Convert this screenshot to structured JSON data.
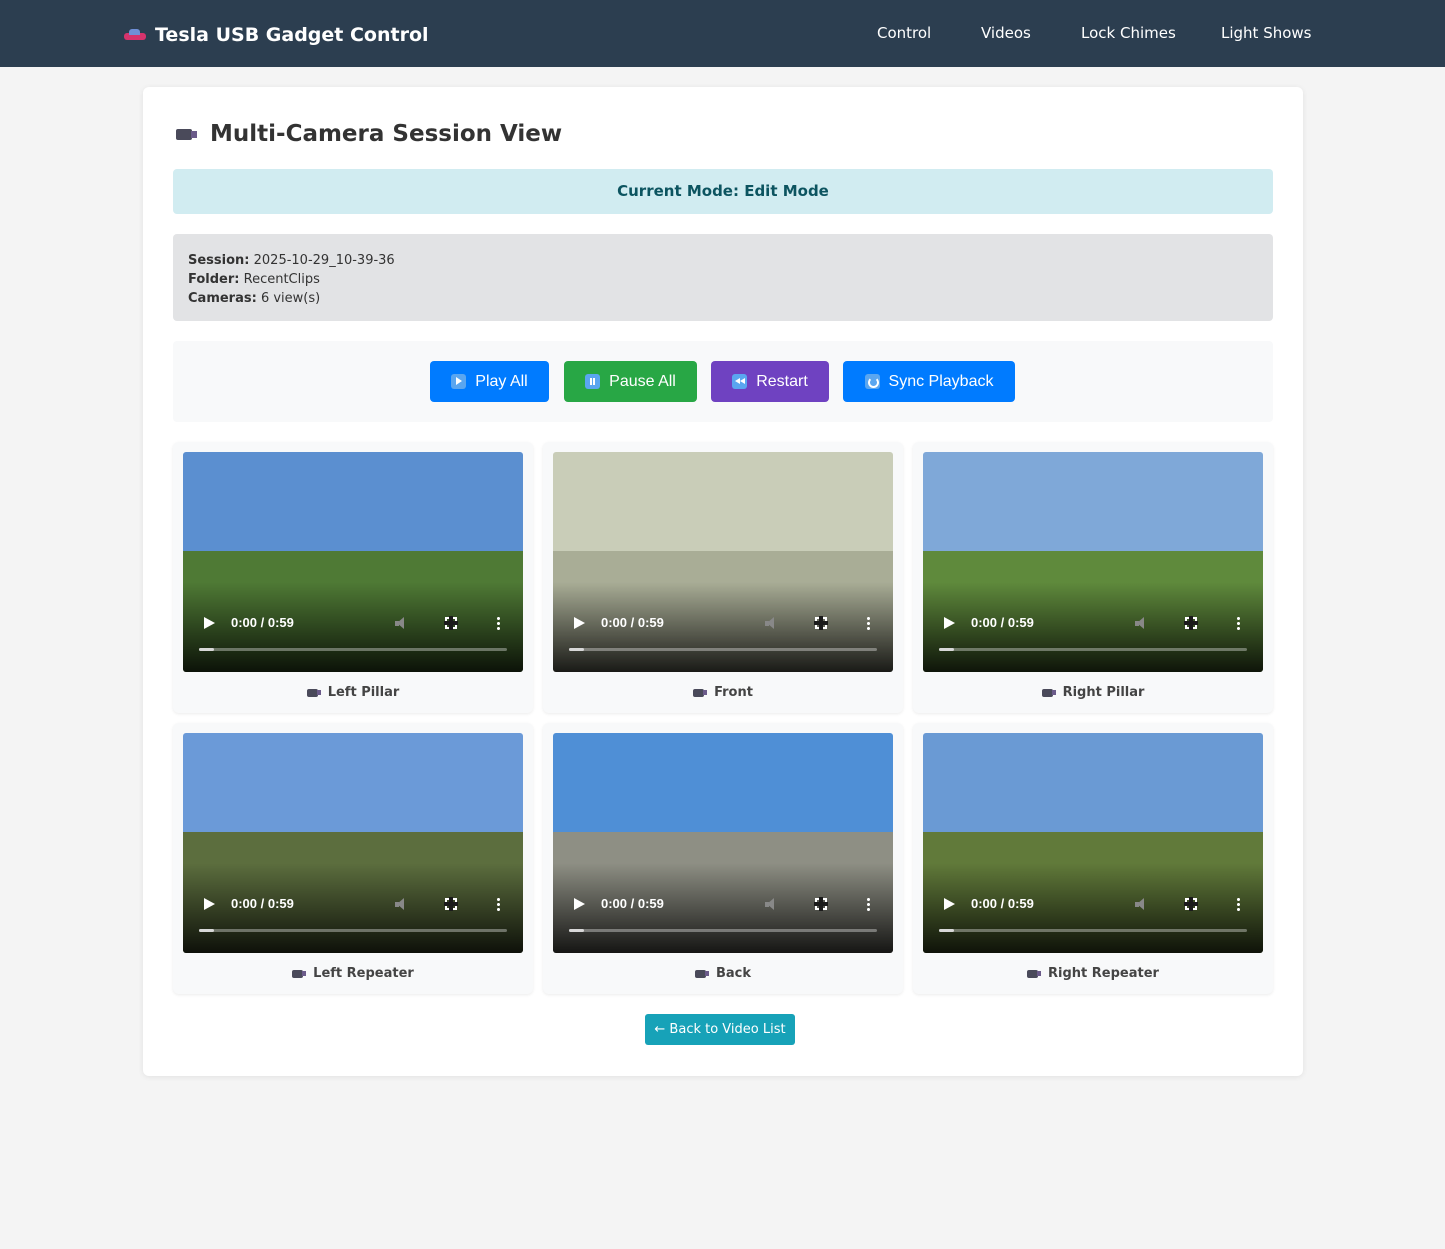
{
  "brand": {
    "title": "Tesla USB Gadget Control",
    "icon": "car-icon"
  },
  "nav": [
    {
      "label": "Control"
    },
    {
      "label": "Videos"
    },
    {
      "label": "Lock Chimes"
    },
    {
      "label": "Light Shows"
    }
  ],
  "page": {
    "title": "Multi-Camera Session View",
    "title_icon": "video-camera-icon"
  },
  "mode_banner": "Current Mode: Edit Mode",
  "session_info": {
    "session_label": "Session:",
    "session_value": "2025-10-29_10-39-36",
    "folder_label": "Folder:",
    "folder_value": "RecentClips",
    "cameras_label": "Cameras:",
    "cameras_value": "6 view(s)"
  },
  "controls": {
    "play_all": "Play All",
    "pause_all": "Pause All",
    "restart": "Restart",
    "sync_playback": "Sync Playback"
  },
  "cameras": [
    {
      "label": "Left Pillar",
      "time": "0:00 / 0:59",
      "progress": 0.05,
      "sky": "#5b8fd0",
      "ground": "#4f7a35"
    },
    {
      "label": "Front",
      "time": "0:00 / 0:59",
      "progress": 0.05,
      "sky": "#c9cdb8",
      "ground": "#a9ad96"
    },
    {
      "label": "Right Pillar",
      "time": "0:00 / 0:59",
      "progress": 0.05,
      "sky": "#7fa8d8",
      "ground": "#5f8a3c"
    },
    {
      "label": "Left Repeater",
      "time": "0:00 / 0:59",
      "progress": 0.05,
      "sky": "#6b9ad8",
      "ground": "#5c6e3e"
    },
    {
      "label": "Back",
      "time": "0:00 / 0:59",
      "progress": 0.05,
      "sky": "#4f8fd6",
      "ground": "#8e8f84"
    },
    {
      "label": "Right Repeater",
      "time": "0:00 / 0:59",
      "progress": 0.05,
      "sky": "#6a9ad4",
      "ground": "#617a3a"
    }
  ],
  "back_button": "← Back to Video List",
  "colors": {
    "navbar": "#2c3e50",
    "mode_banner_bg": "#d1ecf1",
    "mode_banner_text": "#0c5460",
    "btn_play": "#007bff",
    "btn_pause": "#28a745",
    "btn_restart": "#6f42c1",
    "btn_sync": "#007bff",
    "btn_back": "#17a2b8"
  }
}
